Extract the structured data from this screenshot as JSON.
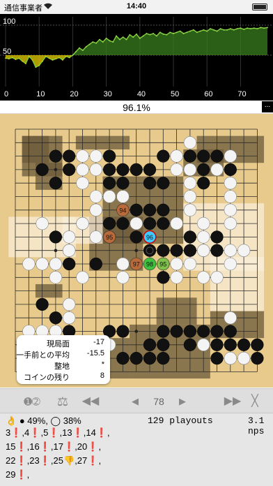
{
  "status_bar": {
    "carrier": "通信事業者",
    "time": "14:40"
  },
  "chart": {
    "y_labels": [
      "100",
      "50"
    ],
    "x_labels": [
      "0",
      "10",
      "20",
      "30",
      "40",
      "50",
      "60",
      "70"
    ]
  },
  "chart_data": {
    "type": "line",
    "x": [
      0,
      1,
      2,
      3,
      4,
      5,
      6,
      7,
      8,
      9,
      10,
      11,
      12,
      13,
      14,
      15,
      16,
      17,
      18,
      19,
      20,
      21,
      22,
      23,
      24,
      25,
      26,
      27,
      28,
      29,
      30,
      31,
      32,
      33,
      34,
      35,
      36,
      37,
      38,
      39,
      40,
      41,
      42,
      43,
      44,
      45,
      46,
      47,
      48,
      49,
      50,
      51,
      52,
      53,
      54,
      55,
      56,
      57,
      58,
      59,
      60,
      61,
      62,
      63,
      64,
      65,
      66,
      67,
      68,
      69,
      70,
      71,
      72,
      73,
      74,
      75,
      76,
      77,
      78
    ],
    "values": [
      45,
      44,
      46,
      43,
      45,
      40,
      36,
      48,
      42,
      30,
      33,
      40,
      48,
      45,
      42,
      44,
      46,
      42,
      48,
      46,
      50,
      56,
      62,
      58,
      64,
      68,
      72,
      70,
      76,
      72,
      78,
      74,
      72,
      82,
      76,
      80,
      76,
      84,
      80,
      85,
      78,
      82,
      86,
      84,
      86,
      82,
      88,
      85,
      84,
      88,
      86,
      88,
      90,
      86,
      88,
      90,
      92,
      88,
      90,
      92,
      90,
      94,
      92,
      90,
      94,
      92,
      92,
      94,
      92,
      94,
      95,
      93,
      95,
      94,
      95,
      94,
      96,
      95,
      96
    ],
    "ylim": [
      0,
      100
    ],
    "xlim": [
      0,
      78
    ],
    "colors": {
      "black_side": "#e8d000",
      "white_side": "#3a7d1e"
    }
  },
  "winrate": "96.1%",
  "more_label": "...",
  "board": {
    "size": 19,
    "black": [
      [
        3,
        2
      ],
      [
        4,
        2
      ],
      [
        7,
        2
      ],
      [
        11,
        2
      ],
      [
        12,
        2
      ],
      [
        13,
        2
      ],
      [
        14,
        2
      ],
      [
        15,
        2
      ],
      [
        2,
        3
      ],
      [
        4,
        3
      ],
      [
        7,
        3
      ],
      [
        8,
        3
      ],
      [
        9,
        3
      ],
      [
        10,
        3
      ],
      [
        14,
        3
      ],
      [
        16,
        3
      ],
      [
        3,
        4
      ],
      [
        7,
        4
      ],
      [
        8,
        4
      ],
      [
        10,
        4
      ],
      [
        11,
        4
      ],
      [
        14,
        4
      ],
      [
        6,
        6
      ],
      [
        9,
        6
      ],
      [
        10,
        6
      ],
      [
        11,
        6
      ],
      [
        5,
        7
      ],
      [
        7,
        7
      ],
      [
        8,
        7
      ],
      [
        10,
        7
      ],
      [
        11,
        7
      ],
      [
        12,
        7
      ],
      [
        3,
        8
      ],
      [
        7,
        8
      ],
      [
        9,
        8
      ],
      [
        13,
        8
      ],
      [
        15,
        8
      ],
      [
        4,
        9
      ],
      [
        10,
        9
      ],
      [
        11,
        9
      ],
      [
        12,
        9
      ],
      [
        13,
        9
      ],
      [
        14,
        9
      ],
      [
        15,
        9
      ],
      [
        2,
        10
      ],
      [
        3,
        10
      ],
      [
        4,
        10
      ],
      [
        6,
        10
      ],
      [
        11,
        10
      ],
      [
        12,
        10
      ],
      [
        11,
        11
      ],
      [
        2,
        13
      ],
      [
        3,
        14
      ],
      [
        3,
        15
      ],
      [
        4,
        15
      ],
      [
        7,
        15
      ],
      [
        8,
        15
      ],
      [
        11,
        15
      ],
      [
        12,
        15
      ],
      [
        13,
        15
      ],
      [
        14,
        15
      ],
      [
        15,
        15
      ],
      [
        16,
        15
      ],
      [
        6,
        16
      ],
      [
        10,
        16
      ],
      [
        11,
        16
      ],
      [
        13,
        16
      ],
      [
        15,
        16
      ],
      [
        16,
        16
      ],
      [
        17,
        16
      ],
      [
        18,
        16
      ],
      [
        8,
        17
      ],
      [
        9,
        17
      ],
      [
        10,
        17
      ],
      [
        11,
        17
      ],
      [
        15,
        17
      ],
      [
        18,
        17
      ]
    ],
    "white": [
      [
        5,
        2
      ],
      [
        6,
        2
      ],
      [
        13,
        1
      ],
      [
        12,
        2
      ],
      [
        16,
        2
      ],
      [
        5,
        3
      ],
      [
        6,
        3
      ],
      [
        12,
        3
      ],
      [
        13,
        3
      ],
      [
        15,
        3
      ],
      [
        5,
        4
      ],
      [
        13,
        4
      ],
      [
        16,
        4
      ],
      [
        6,
        5
      ],
      [
        7,
        5
      ],
      [
        8,
        5
      ],
      [
        13,
        5
      ],
      [
        16,
        5
      ],
      [
        6,
        6
      ],
      [
        13,
        6
      ],
      [
        16,
        6
      ],
      [
        2,
        7
      ],
      [
        5,
        7
      ],
      [
        9,
        7
      ],
      [
        12,
        7
      ],
      [
        14,
        7
      ],
      [
        16,
        7
      ],
      [
        4,
        8
      ],
      [
        6,
        8
      ],
      [
        14,
        8
      ],
      [
        4,
        9
      ],
      [
        14,
        9
      ],
      [
        16,
        9
      ],
      [
        17,
        9
      ],
      [
        3,
        10
      ],
      [
        8,
        10
      ],
      [
        12,
        10
      ],
      [
        13,
        10
      ],
      [
        16,
        10
      ],
      [
        1,
        10
      ],
      [
        2,
        10
      ],
      [
        3,
        11
      ],
      [
        5,
        11
      ],
      [
        8,
        11
      ],
      [
        12,
        11
      ],
      [
        14,
        11
      ],
      [
        15,
        11
      ],
      [
        4,
        13
      ],
      [
        4,
        14
      ],
      [
        16,
        14
      ],
      [
        1,
        15
      ],
      [
        2,
        15
      ],
      [
        3,
        15
      ],
      [
        7,
        16
      ],
      [
        14,
        16
      ],
      [
        2,
        17
      ],
      [
        3,
        17
      ],
      [
        6,
        17
      ],
      [
        16,
        17
      ],
      [
        17,
        17
      ]
    ],
    "candidates": [
      {
        "label": "94",
        "point": [
          8,
          6
        ],
        "color": "#b86a3a"
      },
      {
        "label": "95",
        "point": [
          7,
          8
        ],
        "color": "#b86a3a"
      },
      {
        "label": "96",
        "point": [
          10,
          8
        ],
        "color": "#3fc9ff"
      },
      {
        "label": "97",
        "point": [
          9,
          10
        ],
        "color": "#b86a3a"
      },
      {
        "label": "98",
        "point": [
          10,
          10
        ],
        "color": "#3ec03e"
      },
      {
        "label": "95",
        "point": [
          11,
          10
        ],
        "color": "#7fc04a"
      }
    ]
  },
  "score_popup": {
    "rows": [
      {
        "label": "現局面",
        "value": "-17"
      },
      {
        "label": "一手前との平均",
        "value": "-15.5"
      },
      {
        "label": "整地",
        "value": "*"
      },
      {
        "label": "コインの残り",
        "value": "8"
      }
    ]
  },
  "toolbar": {
    "players_icon": "➊➁",
    "scale_icon": "⚖",
    "rewind_icon": "◀◀",
    "prev_icon": "◀",
    "move_number": "78",
    "next_icon": "▶",
    "fast_forward_icon": "▶▶",
    "close_icon": "╳"
  },
  "stats": {
    "summary_icon": "👌",
    "black_pct": "● 49%,",
    "white_pct": "◯ 38%",
    "playouts": "129 playouts",
    "nps_value": "3.1",
    "nps_unit": "nps"
  },
  "candidate_lines": [
    [
      [
        "3",
        "❗"
      ],
      [
        ",4",
        "❗"
      ],
      [
        ",5",
        "❗"
      ],
      [
        ",13",
        "❗"
      ],
      [
        ",14",
        "❗"
      ],
      [
        ",",
        ""
      ]
    ],
    [
      [
        "15",
        "❗"
      ],
      [
        ",16",
        "❗"
      ],
      [
        ",17",
        "❗"
      ],
      [
        ",20",
        "❗"
      ],
      [
        ",",
        ""
      ]
    ],
    [
      [
        "22",
        "❗"
      ],
      [
        ",23",
        "❗"
      ],
      [
        ",25",
        "👎"
      ],
      [
        ",27",
        "❗"
      ],
      [
        ",",
        ""
      ]
    ],
    [
      [
        "29",
        "❗"
      ],
      [
        ",",
        ""
      ]
    ]
  ]
}
